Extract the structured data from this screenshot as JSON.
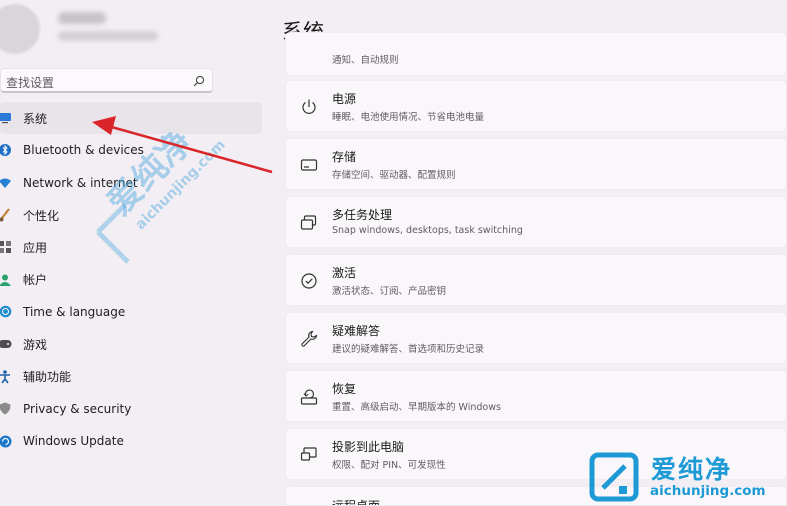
{
  "sidebar": {
    "search_placeholder": "查找设置",
    "items": [
      {
        "label": "系统",
        "icon": "monitor-icon",
        "selected": true
      },
      {
        "label": "Bluetooth & devices",
        "icon": "bluetooth-icon"
      },
      {
        "label": "Network & internet",
        "icon": "wifi-icon"
      },
      {
        "label": "个性化",
        "icon": "brush-icon"
      },
      {
        "label": "应用",
        "icon": "apps-icon"
      },
      {
        "label": "帐户",
        "icon": "account-icon"
      },
      {
        "label": "Time & language",
        "icon": "globe-clock-icon"
      },
      {
        "label": "游戏",
        "icon": "gamepad-icon"
      },
      {
        "label": "辅助功能",
        "icon": "accessibility-icon"
      },
      {
        "label": "Privacy & security",
        "icon": "shield-icon"
      },
      {
        "label": "Windows Update",
        "icon": "update-icon"
      }
    ]
  },
  "main": {
    "title": "系统",
    "partial_top_desc": "通知、自动规则",
    "cards": [
      {
        "title": "电源",
        "desc": "睡眠、电池使用情况、节省电池电量",
        "icon": "power-icon"
      },
      {
        "title": "存储",
        "desc": "存储空间、驱动器、配置规则",
        "icon": "storage-icon"
      },
      {
        "title": "多任务处理",
        "desc": "Snap windows, desktops, task switching",
        "icon": "multitask-icon"
      },
      {
        "title": "激活",
        "desc": "激活状态、订阅、产品密钥",
        "icon": "activation-icon"
      },
      {
        "title": "疑难解答",
        "desc": "建议的疑难解答、首选项和历史记录",
        "icon": "wrench-icon"
      },
      {
        "title": "恢复",
        "desc": "重置、高级启动、早期版本的 Windows",
        "icon": "recovery-icon"
      },
      {
        "title": "投影到此电脑",
        "desc": "权限、配对 PIN、可发现性",
        "icon": "project-icon"
      },
      {
        "title": "远程桌面",
        "desc": "",
        "icon": "remote-desktop-icon"
      }
    ]
  },
  "watermark": {
    "center_text": "爱纯净",
    "center_url": "aichunjing.com",
    "corner_text": "爱纯净",
    "corner_url": "aichunjing.com",
    "color": "#1d9ad6"
  },
  "annotation_color": "#d9252a"
}
